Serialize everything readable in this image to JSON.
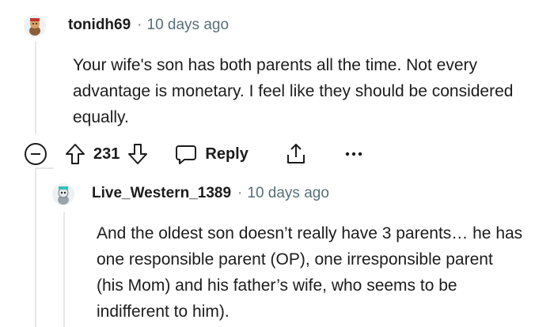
{
  "comments": [
    {
      "username": "tonidh69",
      "time": "10 days ago",
      "body": "Your wife's son has both parents all the time. Not every advantage is monetary. I feel like they should be considered equally.",
      "score": "231",
      "reply_label": "Reply",
      "avatar_icon": "snoo-avatar-icon"
    },
    {
      "username": "Live_Western_1389",
      "time": "10 days ago",
      "body": "And the oldest son doesn’t really have 3 parents… he has one responsible parent (OP), one irresponsible parent (his Mom) and his father’s wife, who seems to be indifferent to him).",
      "avatar_icon": "snoo-avatar-icon"
    }
  ],
  "separator": "·",
  "colors": {
    "text": "#1c1c1c",
    "meta": "#576f76",
    "thread_line": "#e5e8ea",
    "icon": "#1c1c1c"
  }
}
